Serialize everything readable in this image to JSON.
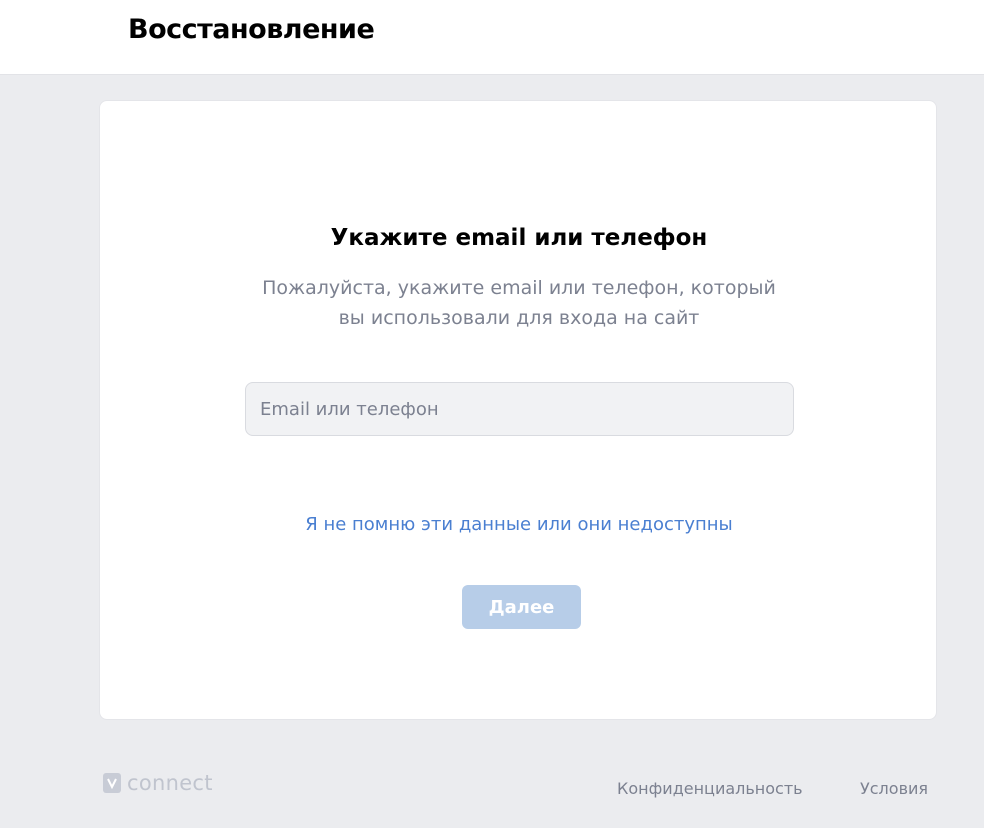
{
  "header": {
    "title": "Восстановление"
  },
  "card": {
    "title": "Укажите email или телефон",
    "description": "Пожалуйста, укажите email или телефон, который вы использовали для входа на сайт",
    "input": {
      "placeholder": "Email или телефон",
      "value": ""
    },
    "forgot_link": "Я не помню эти данные или они недоступны",
    "next_button": "Далее"
  },
  "footer": {
    "logo_text": "connect",
    "privacy_link": "Конфиденциальность",
    "terms_link": "Условия"
  },
  "colors": {
    "background": "#ebecef",
    "link": "#4a7fd1",
    "button_disabled": "#b7cde8",
    "muted_text": "#7c8190"
  }
}
